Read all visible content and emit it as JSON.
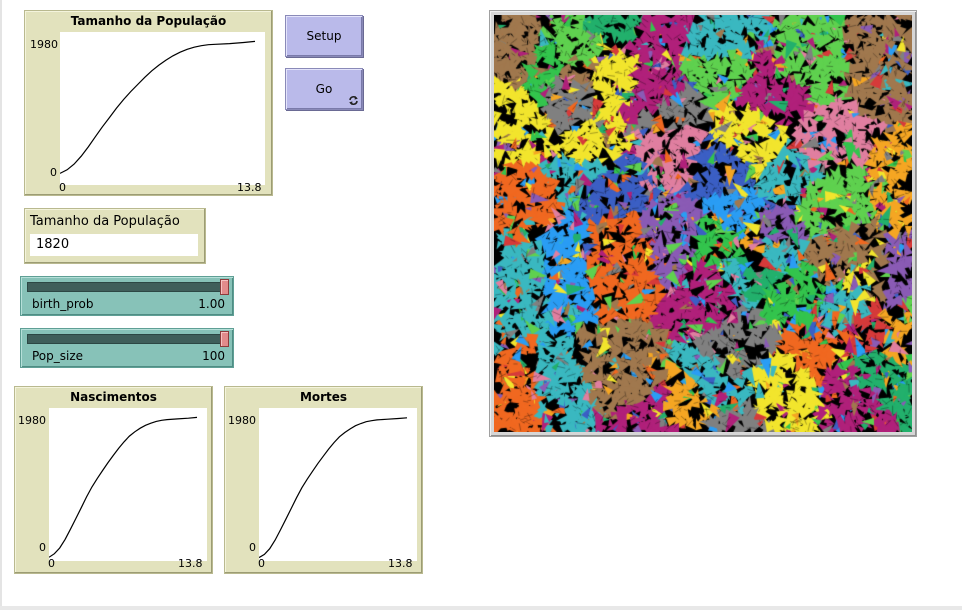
{
  "plots": {
    "population": {
      "title": "Tamanho da População",
      "y_max": "1980",
      "y_min": "0",
      "x_min": "0",
      "x_max": "13.8"
    },
    "births": {
      "title": "Nascimentos",
      "y_max": "1980",
      "y_min": "0",
      "x_min": "0",
      "x_max": "13.8"
    },
    "deaths": {
      "title": "Mortes",
      "y_max": "1980",
      "y_min": "0",
      "x_min": "0",
      "x_max": "13.8"
    }
  },
  "buttons": {
    "setup": "Setup",
    "go": "Go"
  },
  "monitor": {
    "label": "Tamanho da População",
    "value": "1820"
  },
  "sliders": {
    "birth_prob": {
      "name": "birth_prob",
      "value": "1.00",
      "level": 1.0
    },
    "pop_size": {
      "name": "Pop_size",
      "value": "100",
      "level": 1.0
    }
  },
  "world": {
    "background": "#000000",
    "palette": [
      "#2a9df4",
      "#33c44d",
      "#f06820",
      "#f2e52d",
      "#d63a3a",
      "#3b5fc4",
      "#b0207a",
      "#a0784e",
      "#22b06c",
      "#3ab8c0",
      "#e07fa0",
      "#8a5bb5",
      "#5fd14f",
      "#f5a623",
      "#808080"
    ]
  },
  "colors": {
    "plot_bg": "#e2e2bd",
    "button_bg": "#babaea",
    "slider_bg": "#87c2b8",
    "plot_line": "#000000"
  },
  "icons": {
    "go_forever": "forever-arrows-icon"
  },
  "chart_data": [
    {
      "type": "line",
      "title": "Tamanho da População",
      "xlim": [
        0,
        13.8
      ],
      "ylim": [
        0,
        1980
      ],
      "series": [
        {
          "x": [
            0,
            0.5,
            1,
            1.5,
            2,
            2.5,
            3,
            3.5,
            4,
            4.5,
            5,
            5.5,
            6,
            6.5,
            7,
            7.5,
            8,
            8.5,
            9,
            9.5,
            10,
            10.5,
            11,
            12,
            13,
            13.8
          ],
          "values": [
            120,
            170,
            250,
            360,
            490,
            630,
            770,
            900,
            1030,
            1150,
            1260,
            1360,
            1460,
            1550,
            1630,
            1700,
            1760,
            1810,
            1850,
            1880,
            1900,
            1915,
            1920,
            1930,
            1945,
            1960
          ]
        }
      ]
    },
    {
      "type": "line",
      "title": "Nascimentos",
      "xlim": [
        0,
        13.8
      ],
      "ylim": [
        0,
        1980
      ],
      "series": [
        {
          "x": [
            0,
            0.5,
            1,
            1.5,
            2,
            2.5,
            3,
            3.5,
            4,
            4.5,
            5,
            5.5,
            6,
            6.5,
            7,
            7.5,
            8,
            8.5,
            9,
            9.5,
            10,
            10.5,
            11,
            12,
            13,
            13.8
          ],
          "values": [
            10,
            60,
            140,
            260,
            400,
            550,
            700,
            850,
            990,
            1110,
            1220,
            1330,
            1430,
            1530,
            1620,
            1700,
            1760,
            1810,
            1850,
            1880,
            1905,
            1920,
            1930,
            1940,
            1950,
            1960
          ]
        }
      ]
    },
    {
      "type": "line",
      "title": "Mortes",
      "xlim": [
        0,
        13.8
      ],
      "ylim": [
        0,
        1980
      ],
      "series": [
        {
          "x": [
            0,
            0.5,
            1,
            1.5,
            2,
            2.5,
            3,
            3.5,
            4,
            4.5,
            5,
            5.5,
            6,
            6.5,
            7,
            7.5,
            8,
            8.5,
            9,
            9.5,
            10,
            10.5,
            11,
            12,
            13,
            13.8
          ],
          "values": [
            5,
            50,
            130,
            250,
            390,
            540,
            690,
            840,
            980,
            1100,
            1210,
            1320,
            1420,
            1520,
            1610,
            1690,
            1750,
            1800,
            1845,
            1875,
            1900,
            1915,
            1925,
            1935,
            1945,
            1955
          ]
        }
      ]
    }
  ]
}
